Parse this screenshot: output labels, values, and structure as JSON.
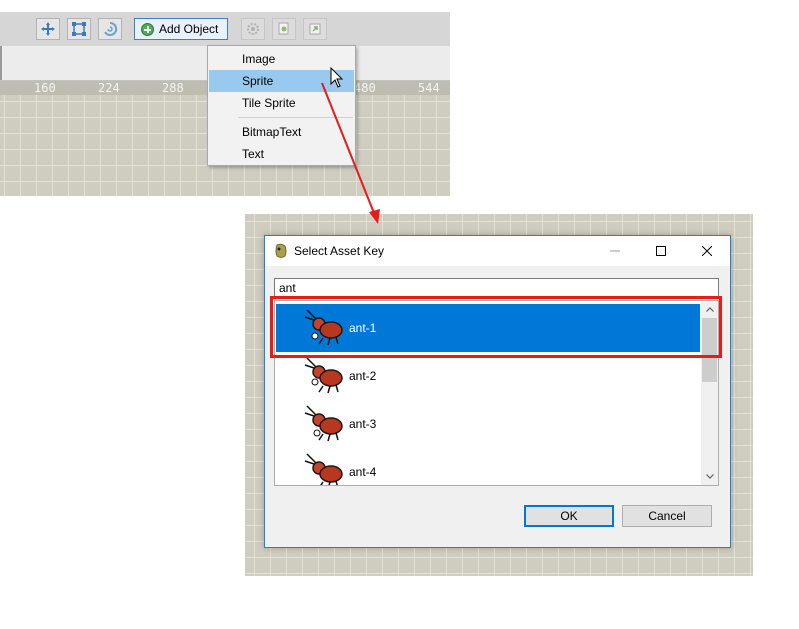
{
  "toolbar": {
    "add_object_label": "Add Object",
    "icons": [
      "move-icon",
      "resize-icon",
      "rotate-icon",
      "settings-icon",
      "copy-icon",
      "export-icon"
    ]
  },
  "ruler": {
    "labels": [
      "160",
      "224",
      "288",
      "480",
      "544"
    ]
  },
  "context_menu": {
    "items": [
      {
        "label": "Image"
      },
      {
        "label": "Sprite"
      },
      {
        "label": "Tile Sprite"
      },
      {
        "label": "BitmapText"
      },
      {
        "label": "Text"
      }
    ],
    "highlighted": "Sprite"
  },
  "dialog": {
    "title": "Select Asset Key",
    "search_value": "ant",
    "assets": [
      {
        "label": "ant-1"
      },
      {
        "label": "ant-2"
      },
      {
        "label": "ant-3"
      },
      {
        "label": "ant-4"
      }
    ],
    "selected": "ant-1",
    "ok_label": "OK",
    "cancel_label": "Cancel"
  },
  "colors": {
    "selection": "#0078d7",
    "menu_highlight": "#99c9ef",
    "annotation": "#e81b1b",
    "canvas": "#cfcdbf"
  }
}
